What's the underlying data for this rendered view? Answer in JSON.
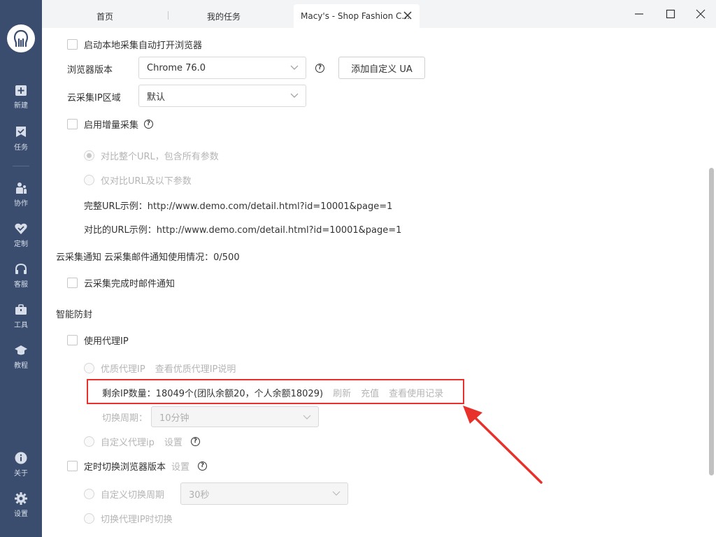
{
  "sidebar": {
    "items": [
      {
        "label": "新建",
        "icon": "plus-icon"
      },
      {
        "label": "任务",
        "icon": "flag-icon"
      },
      {
        "label": "协作",
        "icon": "people-icon"
      },
      {
        "label": "定制",
        "icon": "heart-check-icon"
      },
      {
        "label": "客服",
        "icon": "headset-icon"
      },
      {
        "label": "工具",
        "icon": "toolbox-icon"
      },
      {
        "label": "教程",
        "icon": "graduation-cap-icon"
      },
      {
        "label": "关于",
        "icon": "info-icon"
      },
      {
        "label": "设置",
        "icon": "gear-icon"
      }
    ]
  },
  "tabs": {
    "home": "首页",
    "tasks": "我的任务",
    "active": "Macy's - Shop Fashion C..."
  },
  "settings": {
    "auto_open_browser": "启动本地采集自动打开浏览器",
    "browser_version_label": "浏览器版本",
    "browser_version_value": "Chrome 76.0",
    "add_ua_button": "添加自定义 UA",
    "ip_region_label": "云采集IP区域",
    "ip_region_value": "默认",
    "incremental_label": "启用增量采集",
    "compare_full_url": "对比整个URL，包含所有参数",
    "compare_partial_url": "仅对比URL及以下参数",
    "full_url_example": "完整URL示例：http://www.demo.com/detail.html?id=10001&page=1",
    "compare_url_example": "对比的URL示例：http://www.demo.com/detail.html?id=10001&page=1",
    "cloud_notify": "云采集通知 云采集邮件通知使用情况：0/500",
    "email_on_complete": "云采集完成时邮件通知",
    "anti_block_heading": "智能防封",
    "use_proxy_ip": "使用代理IP",
    "premium_proxy": "优质代理IP",
    "view_premium_proxy_info": "查看优质代理IP说明",
    "remaining_ip": "剩余IP数量：18049个(团队余额20，个人余额18029)",
    "refresh_link": "刷新",
    "recharge_link": "充值",
    "usage_history_link": "查看使用记录",
    "switch_period_label": "切换周期：",
    "switch_period_value": "10分钟",
    "custom_proxy": "自定义代理ip",
    "custom_proxy_settings": "设置",
    "timed_switch_browser": "定时切换浏览器版本",
    "timed_switch_settings": "设置",
    "custom_switch_period": "自定义切换周期",
    "custom_switch_period_value": "30秒",
    "switch_on_proxy_change": "切换代理IP时切换"
  },
  "colors": {
    "sidebar_bg": "#3a4d6e",
    "highlight_red": "#e8312a"
  }
}
